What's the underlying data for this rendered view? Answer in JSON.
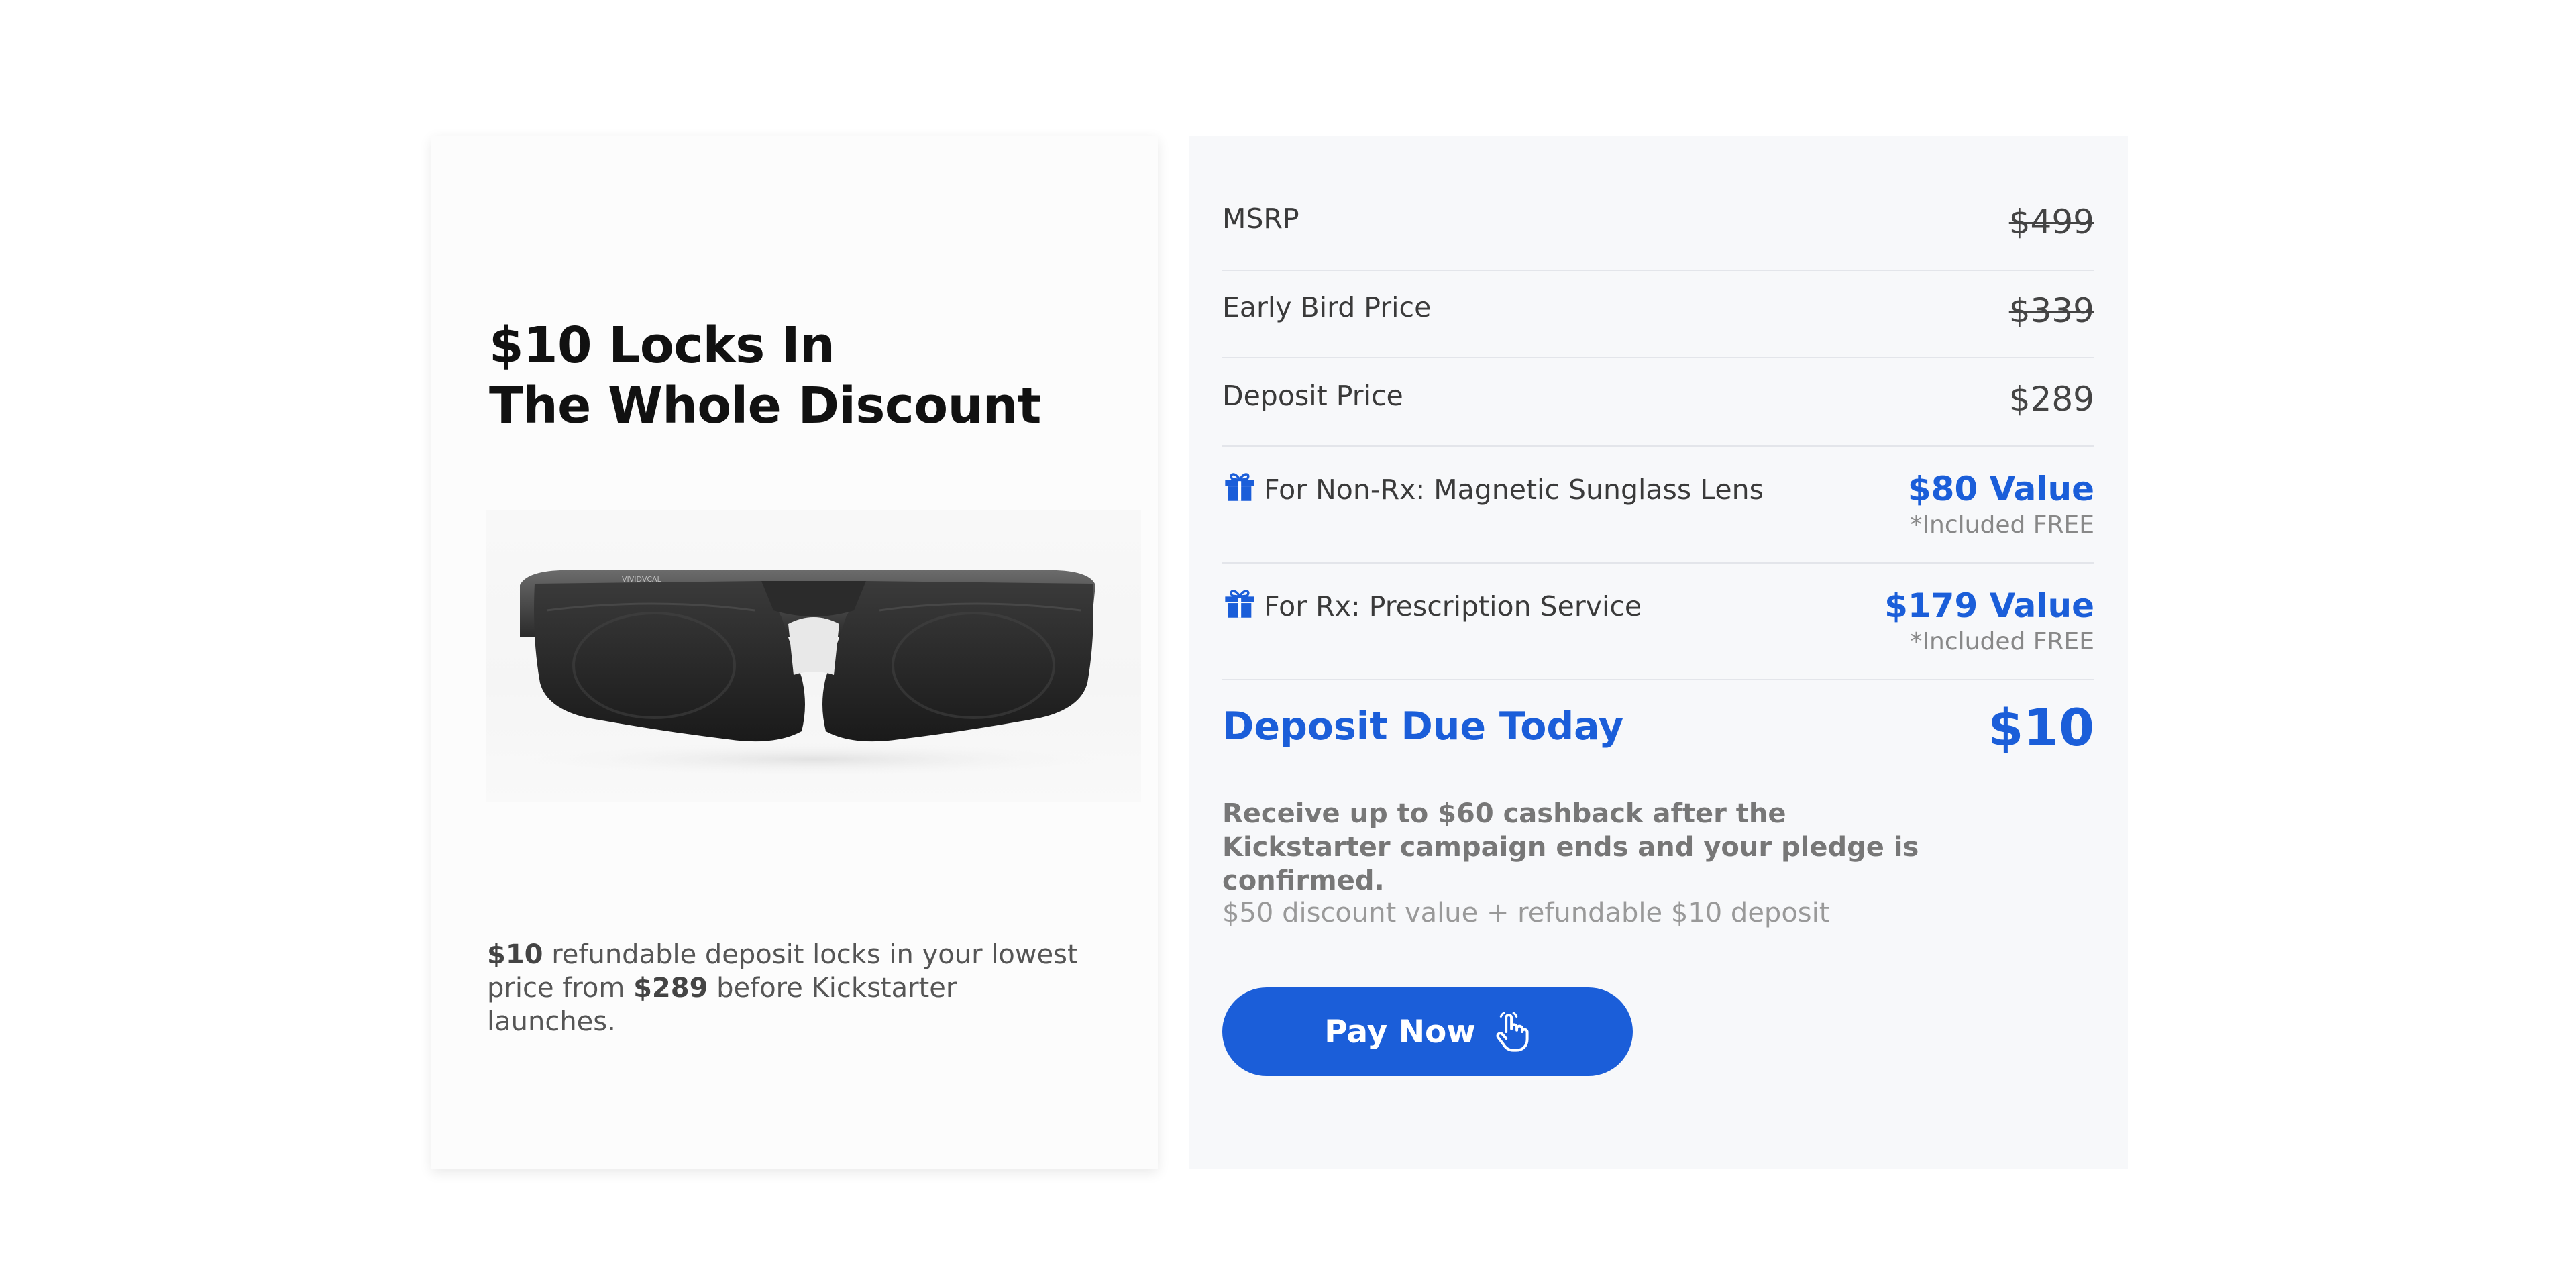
{
  "offer": {
    "headline_line1": "$10 Locks In",
    "headline_line2": "The Whole Discount",
    "product_image": "smart-glasses-photo",
    "product_brand": "VIVIDVCAL",
    "deposit_note": {
      "amount": "$10",
      "text_1": " refundable deposit locks in your lowest price from ",
      "price": "$289",
      "text_2": " before Kickstarter launches."
    }
  },
  "pricing": {
    "msrp": {
      "label": "MSRP",
      "value": "$499"
    },
    "early_bird": {
      "label": "Early Bird Price",
      "value": "$339"
    },
    "deposit_price": {
      "label": "Deposit Price",
      "value": "$289"
    },
    "perks": [
      {
        "icon": "gift-icon",
        "label": "For Non-Rx: Magnetic Sunglass Lens",
        "value": "$80 Value",
        "note": "*Included FREE"
      },
      {
        "icon": "gift-icon",
        "label": "For Rx: Prescription Service",
        "value": "$179 Value",
        "note": "*Included FREE"
      }
    ],
    "due_today": {
      "label": "Deposit Due Today",
      "amount": "$10"
    },
    "cashback_note": "Receive up to $60 cashback after the Kickstarter campaign ends and your pledge is confirmed.",
    "discount_note": "$50 discount value + refundable $10 deposit"
  },
  "cta": {
    "label": "Pay Now",
    "icon": "pointer-hand-icon"
  },
  "colors": {
    "accent": "#1b5ed9",
    "panel_background": "#f7f8fa",
    "card_background": "#fcfcfc"
  }
}
